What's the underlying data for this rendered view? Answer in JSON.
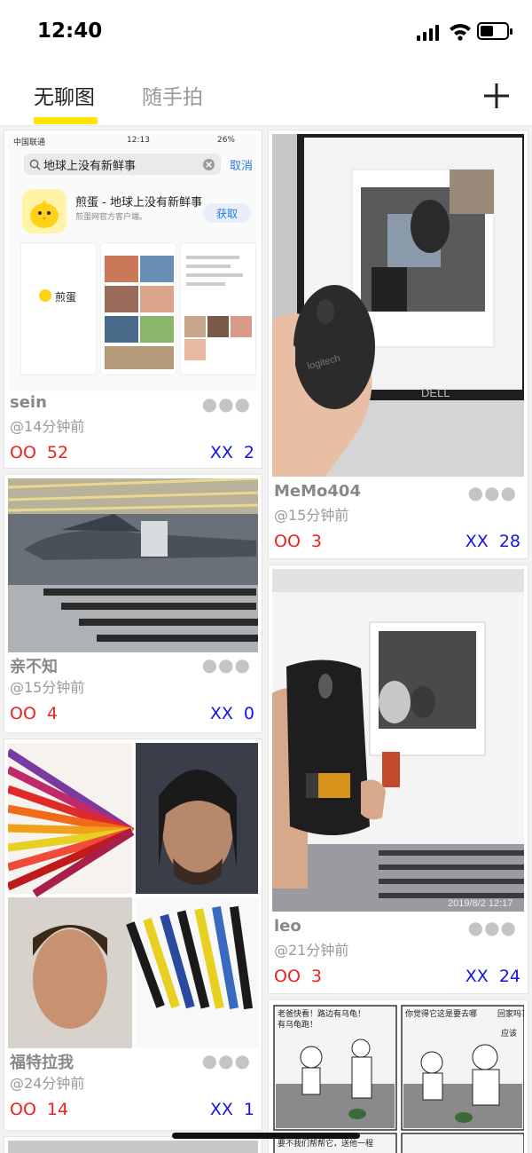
{
  "status_bar": {
    "time": "12:40"
  },
  "tabs": [
    {
      "label": "无聊图"
    },
    {
      "label": "随手拍"
    }
  ],
  "colors": {
    "accent": "#ffe500",
    "oo": "#f02020",
    "xx": "#1515e6"
  },
  "cards": [
    {
      "user": "sein",
      "ago": "@14分钟前",
      "oo_label": "OO",
      "oo": "52",
      "xx_label": "XX",
      "xx": "2"
    },
    {
      "user": "MeMo404",
      "ago": "@15分钟前",
      "oo_label": "OO",
      "oo": "3",
      "xx_label": "XX",
      "xx": "28"
    },
    {
      "user": "亲不知",
      "ago": "@15分钟前",
      "oo_label": "OO",
      "oo": "4",
      "xx_label": "XX",
      "xx": "0"
    },
    {
      "user": "leo",
      "ago": "@21分钟前",
      "oo_label": "OO",
      "oo": "3",
      "xx_label": "XX",
      "xx": "24"
    },
    {
      "user": "福特拉我",
      "ago": "@24分钟前",
      "oo_label": "OO",
      "oo": "14",
      "xx_label": "XX",
      "xx": "1"
    }
  ],
  "screenshot_card": {
    "carrier": "中国联通",
    "time": "12:13",
    "battery": "26%",
    "search": "地球上没有新鲜事",
    "cancel": "取消",
    "app_name": "煎蛋 - 地球上没有新鲜事",
    "app_sub": "煎蛋网官方客户端。",
    "get": "获取",
    "logo_text": "煎蛋"
  },
  "photo_texts": {
    "mouse_brand": "logitech",
    "monitor_brand": "DELL",
    "photo_timestamp": "2019/8/2 12:17"
  },
  "comic": {
    "panel1": "老爸快看！路边有乌龟！",
    "panel1b": "有乌龟跑！",
    "panel2": "你觉得它这是要去哪",
    "panel2b": "回家吗？",
    "panel2c": "应该",
    "panel3": "要不我们帮帮它，送他一程"
  },
  "more_icon": "ellipsis-icon",
  "add_icon": "plus-icon"
}
